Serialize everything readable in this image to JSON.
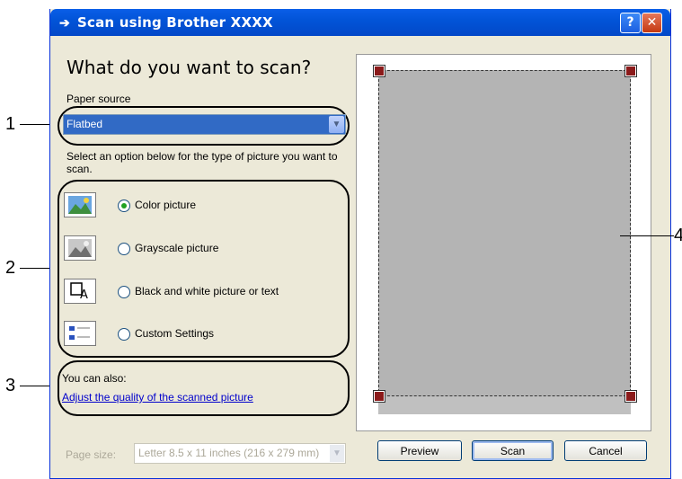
{
  "window": {
    "title": "Scan using Brother  XXXX",
    "help_label": "?",
    "close_label": "✕"
  },
  "main": {
    "heading": "What do you want to scan?",
    "paper_source_label": "Paper source",
    "paper_source_value": "Flatbed",
    "instructions": "Select an option below for the type of picture you want to scan.",
    "options": [
      {
        "label": "Color picture",
        "selected": true
      },
      {
        "label": "Grayscale picture",
        "selected": false
      },
      {
        "label": "Black and white picture or text",
        "selected": false
      },
      {
        "label": "Custom Settings",
        "selected": false
      }
    ],
    "also_label": "You can also:",
    "adjust_link": "Adjust the quality of the scanned picture",
    "page_size_label": "Page size:",
    "page_size_value": "Letter 8.5 x 11 inches (216 x 279 mm)"
  },
  "buttons": {
    "preview": "Preview",
    "scan": "Scan",
    "cancel": "Cancel"
  },
  "callouts": [
    "1",
    "2",
    "3",
    "4"
  ],
  "colors": {
    "titlebar": "#0254d8",
    "selection": "#316ac5",
    "crop_handle": "#8b1a1a",
    "link": "#0000cc"
  }
}
